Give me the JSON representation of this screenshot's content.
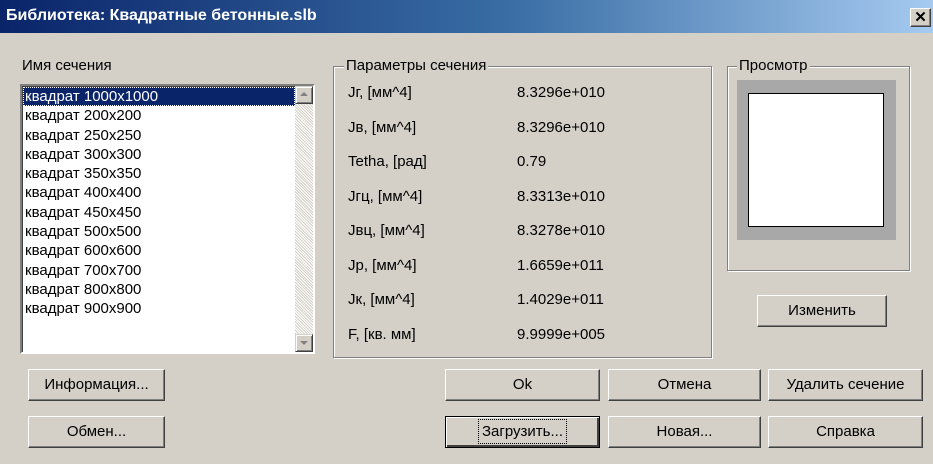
{
  "window": {
    "title": "Библиотека: Квадратные бетонные.slb",
    "close_glyph": "✕"
  },
  "section_list": {
    "label": "Имя сечения",
    "selected_index": 0,
    "items": [
      "квадрат 1000x1000",
      "квадрат 200x200",
      "квадрат 250x250",
      "квадрат 300x300",
      "квадрат 350x350",
      "квадрат 400x400",
      "квадрат 450x450",
      "квадрат 500x500",
      "квадрат 600x600",
      "квадрат 700x700",
      "квадрат 800x800",
      "квадрат 900x900"
    ]
  },
  "parameters": {
    "label": "Параметры сечения",
    "rows": [
      {
        "name": "Jг, [мм^4]",
        "value": "8.3296e+010"
      },
      {
        "name": "Jв, [мм^4]",
        "value": "8.3296e+010"
      },
      {
        "name": "Tetha, [рад]",
        "value": "0.79"
      },
      {
        "name": "Jгц, [мм^4]",
        "value": "8.3313e+010"
      },
      {
        "name": "Jвц, [мм^4]",
        "value": "8.3278e+010"
      },
      {
        "name": "Jр, [мм^4]",
        "value": "1.6659e+011"
      },
      {
        "name": "Jк, [мм^4]",
        "value": "1.4029e+011"
      },
      {
        "name": "F, [кв. мм]",
        "value": "9.9999e+005"
      }
    ]
  },
  "preview": {
    "label": "Просмотр",
    "edit_button": "Изменить"
  },
  "buttons": {
    "info": "Информация...",
    "exchange": "Обмен...",
    "ok": "Ok",
    "cancel": "Отмена",
    "delete": "Удалить сечение",
    "load": "Загрузить...",
    "new": "Новая...",
    "help": "Справка"
  }
}
